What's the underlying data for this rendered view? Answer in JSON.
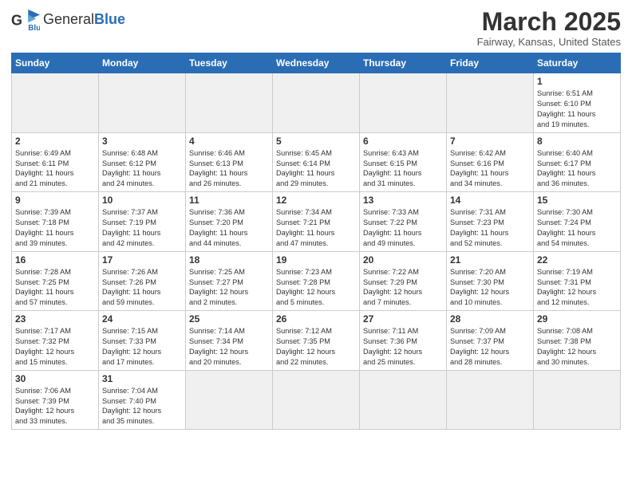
{
  "logo": {
    "line1": "General",
    "line2": "Blue"
  },
  "title": "March 2025",
  "subtitle": "Fairway, Kansas, United States",
  "days_of_week": [
    "Sunday",
    "Monday",
    "Tuesday",
    "Wednesday",
    "Thursday",
    "Friday",
    "Saturday"
  ],
  "weeks": [
    [
      {
        "day": "",
        "info": "",
        "empty": true
      },
      {
        "day": "",
        "info": "",
        "empty": true
      },
      {
        "day": "",
        "info": "",
        "empty": true
      },
      {
        "day": "",
        "info": "",
        "empty": true
      },
      {
        "day": "",
        "info": "",
        "empty": true
      },
      {
        "day": "",
        "info": "",
        "empty": true
      },
      {
        "day": "1",
        "info": "Sunrise: 6:51 AM\nSunset: 6:10 PM\nDaylight: 11 hours\nand 19 minutes."
      }
    ],
    [
      {
        "day": "2",
        "info": "Sunrise: 6:49 AM\nSunset: 6:11 PM\nDaylight: 11 hours\nand 21 minutes."
      },
      {
        "day": "3",
        "info": "Sunrise: 6:48 AM\nSunset: 6:12 PM\nDaylight: 11 hours\nand 24 minutes."
      },
      {
        "day": "4",
        "info": "Sunrise: 6:46 AM\nSunset: 6:13 PM\nDaylight: 11 hours\nand 26 minutes."
      },
      {
        "day": "5",
        "info": "Sunrise: 6:45 AM\nSunset: 6:14 PM\nDaylight: 11 hours\nand 29 minutes."
      },
      {
        "day": "6",
        "info": "Sunrise: 6:43 AM\nSunset: 6:15 PM\nDaylight: 11 hours\nand 31 minutes."
      },
      {
        "day": "7",
        "info": "Sunrise: 6:42 AM\nSunset: 6:16 PM\nDaylight: 11 hours\nand 34 minutes."
      },
      {
        "day": "8",
        "info": "Sunrise: 6:40 AM\nSunset: 6:17 PM\nDaylight: 11 hours\nand 36 minutes."
      }
    ],
    [
      {
        "day": "9",
        "info": "Sunrise: 7:39 AM\nSunset: 7:18 PM\nDaylight: 11 hours\nand 39 minutes."
      },
      {
        "day": "10",
        "info": "Sunrise: 7:37 AM\nSunset: 7:19 PM\nDaylight: 11 hours\nand 42 minutes."
      },
      {
        "day": "11",
        "info": "Sunrise: 7:36 AM\nSunset: 7:20 PM\nDaylight: 11 hours\nand 44 minutes."
      },
      {
        "day": "12",
        "info": "Sunrise: 7:34 AM\nSunset: 7:21 PM\nDaylight: 11 hours\nand 47 minutes."
      },
      {
        "day": "13",
        "info": "Sunrise: 7:33 AM\nSunset: 7:22 PM\nDaylight: 11 hours\nand 49 minutes."
      },
      {
        "day": "14",
        "info": "Sunrise: 7:31 AM\nSunset: 7:23 PM\nDaylight: 11 hours\nand 52 minutes."
      },
      {
        "day": "15",
        "info": "Sunrise: 7:30 AM\nSunset: 7:24 PM\nDaylight: 11 hours\nand 54 minutes."
      }
    ],
    [
      {
        "day": "16",
        "info": "Sunrise: 7:28 AM\nSunset: 7:25 PM\nDaylight: 11 hours\nand 57 minutes."
      },
      {
        "day": "17",
        "info": "Sunrise: 7:26 AM\nSunset: 7:26 PM\nDaylight: 11 hours\nand 59 minutes."
      },
      {
        "day": "18",
        "info": "Sunrise: 7:25 AM\nSunset: 7:27 PM\nDaylight: 12 hours\nand 2 minutes."
      },
      {
        "day": "19",
        "info": "Sunrise: 7:23 AM\nSunset: 7:28 PM\nDaylight: 12 hours\nand 5 minutes."
      },
      {
        "day": "20",
        "info": "Sunrise: 7:22 AM\nSunset: 7:29 PM\nDaylight: 12 hours\nand 7 minutes."
      },
      {
        "day": "21",
        "info": "Sunrise: 7:20 AM\nSunset: 7:30 PM\nDaylight: 12 hours\nand 10 minutes."
      },
      {
        "day": "22",
        "info": "Sunrise: 7:19 AM\nSunset: 7:31 PM\nDaylight: 12 hours\nand 12 minutes."
      }
    ],
    [
      {
        "day": "23",
        "info": "Sunrise: 7:17 AM\nSunset: 7:32 PM\nDaylight: 12 hours\nand 15 minutes."
      },
      {
        "day": "24",
        "info": "Sunrise: 7:15 AM\nSunset: 7:33 PM\nDaylight: 12 hours\nand 17 minutes."
      },
      {
        "day": "25",
        "info": "Sunrise: 7:14 AM\nSunset: 7:34 PM\nDaylight: 12 hours\nand 20 minutes."
      },
      {
        "day": "26",
        "info": "Sunrise: 7:12 AM\nSunset: 7:35 PM\nDaylight: 12 hours\nand 22 minutes."
      },
      {
        "day": "27",
        "info": "Sunrise: 7:11 AM\nSunset: 7:36 PM\nDaylight: 12 hours\nand 25 minutes."
      },
      {
        "day": "28",
        "info": "Sunrise: 7:09 AM\nSunset: 7:37 PM\nDaylight: 12 hours\nand 28 minutes."
      },
      {
        "day": "29",
        "info": "Sunrise: 7:08 AM\nSunset: 7:38 PM\nDaylight: 12 hours\nand 30 minutes."
      }
    ],
    [
      {
        "day": "30",
        "info": "Sunrise: 7:06 AM\nSunset: 7:39 PM\nDaylight: 12 hours\nand 33 minutes."
      },
      {
        "day": "31",
        "info": "Sunrise: 7:04 AM\nSunset: 7:40 PM\nDaylight: 12 hours\nand 35 minutes."
      },
      {
        "day": "",
        "info": "",
        "empty": true
      },
      {
        "day": "",
        "info": "",
        "empty": true
      },
      {
        "day": "",
        "info": "",
        "empty": true
      },
      {
        "day": "",
        "info": "",
        "empty": true
      },
      {
        "day": "",
        "info": "",
        "empty": true
      }
    ]
  ]
}
